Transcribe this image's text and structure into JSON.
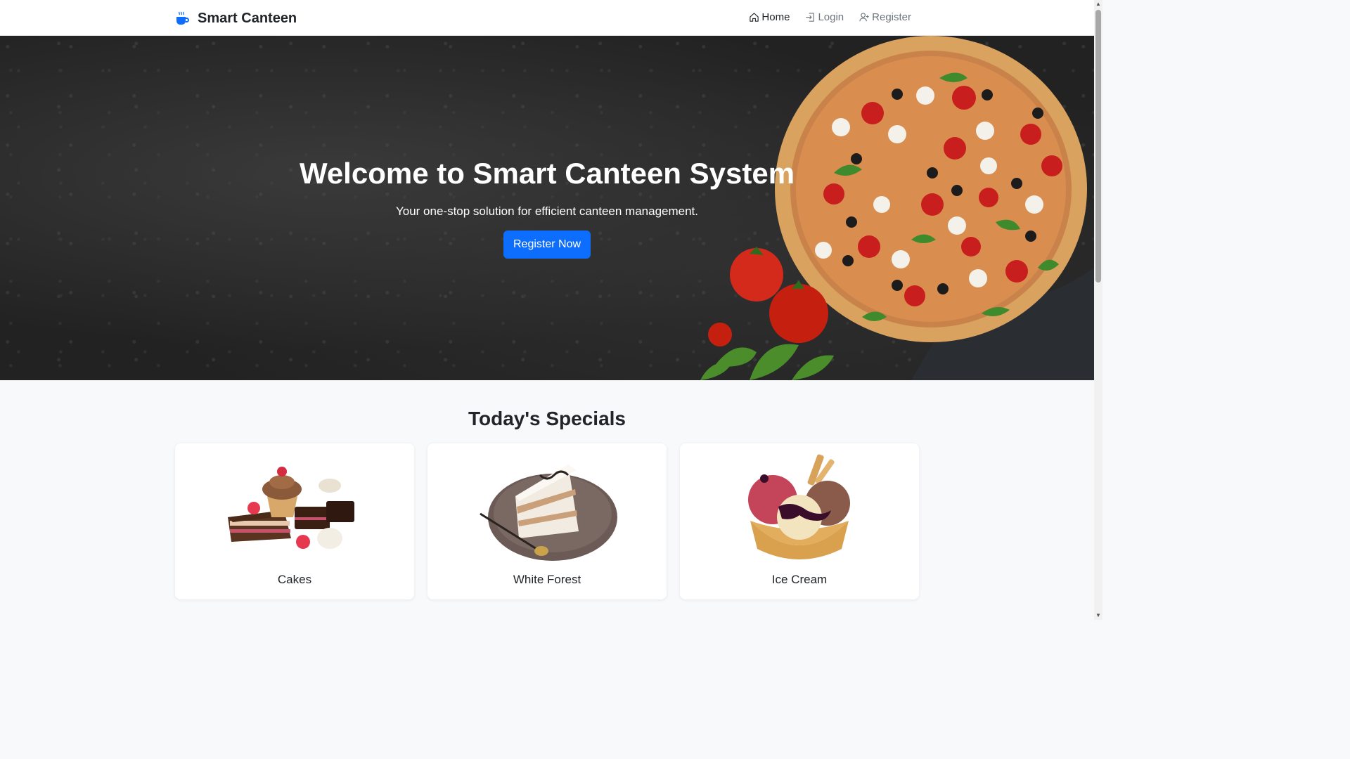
{
  "navbar": {
    "brand": "Smart Canteen",
    "brand_icon": "coffee-cup-icon",
    "links": [
      {
        "label": "Home",
        "icon": "house-icon"
      },
      {
        "label": "Login",
        "icon": "login-icon"
      },
      {
        "label": "Register",
        "icon": "person-plus-icon"
      }
    ]
  },
  "hero": {
    "title": "Welcome to Smart Canteen System",
    "subtitle": "Your one-stop solution for efficient canteen management.",
    "cta_label": "Register Now"
  },
  "specials": {
    "title": "Today's Specials",
    "items": [
      {
        "label": "Cakes"
      },
      {
        "label": "White Forest"
      },
      {
        "label": "Ice Cream"
      }
    ]
  },
  "colors": {
    "primary": "#0d6efd",
    "hero_bg": "#222222",
    "page_bg": "#f8f9fa"
  }
}
